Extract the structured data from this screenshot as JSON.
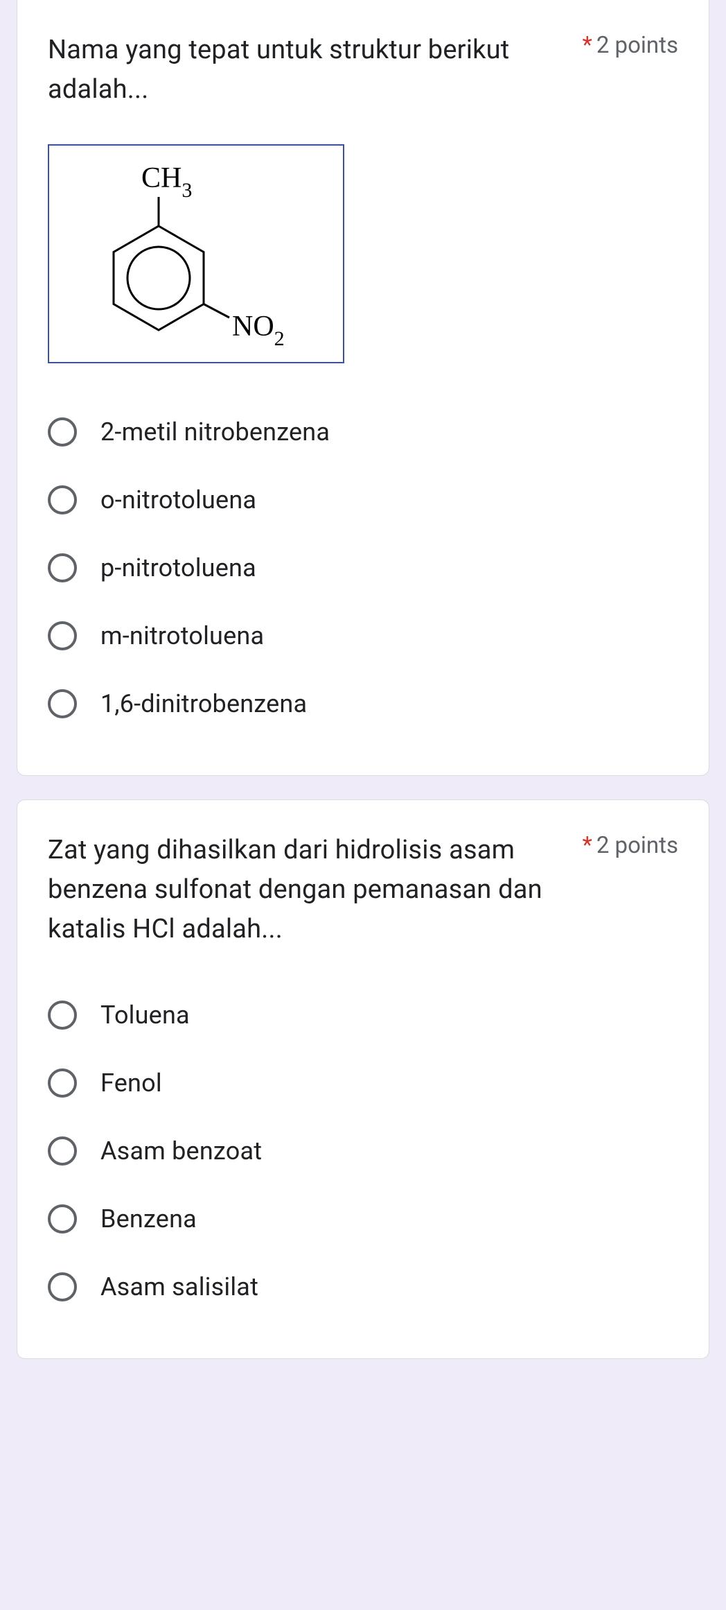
{
  "questions": [
    {
      "title": "Nama yang tepat untuk struktur berikut adalah...",
      "required_marker": "*",
      "points_label": "2 points",
      "structure": {
        "top_label": "CH3",
        "right_label": "NO2"
      },
      "options": [
        "2-metil nitrobenzena",
        "o-nitrotoluena",
        "p-nitrotoluena",
        "m-nitrotoluena",
        "1,6-dinitrobenzena"
      ]
    },
    {
      "title": "Zat yang dihasilkan dari hidrolisis asam benzena sulfonat dengan pemanasan dan katalis HCl adalah...",
      "required_marker": "*",
      "points_label": "2 points",
      "options": [
        "Toluena",
        "Fenol",
        "Asam benzoat",
        "Benzena",
        "Asam salisilat"
      ]
    }
  ]
}
